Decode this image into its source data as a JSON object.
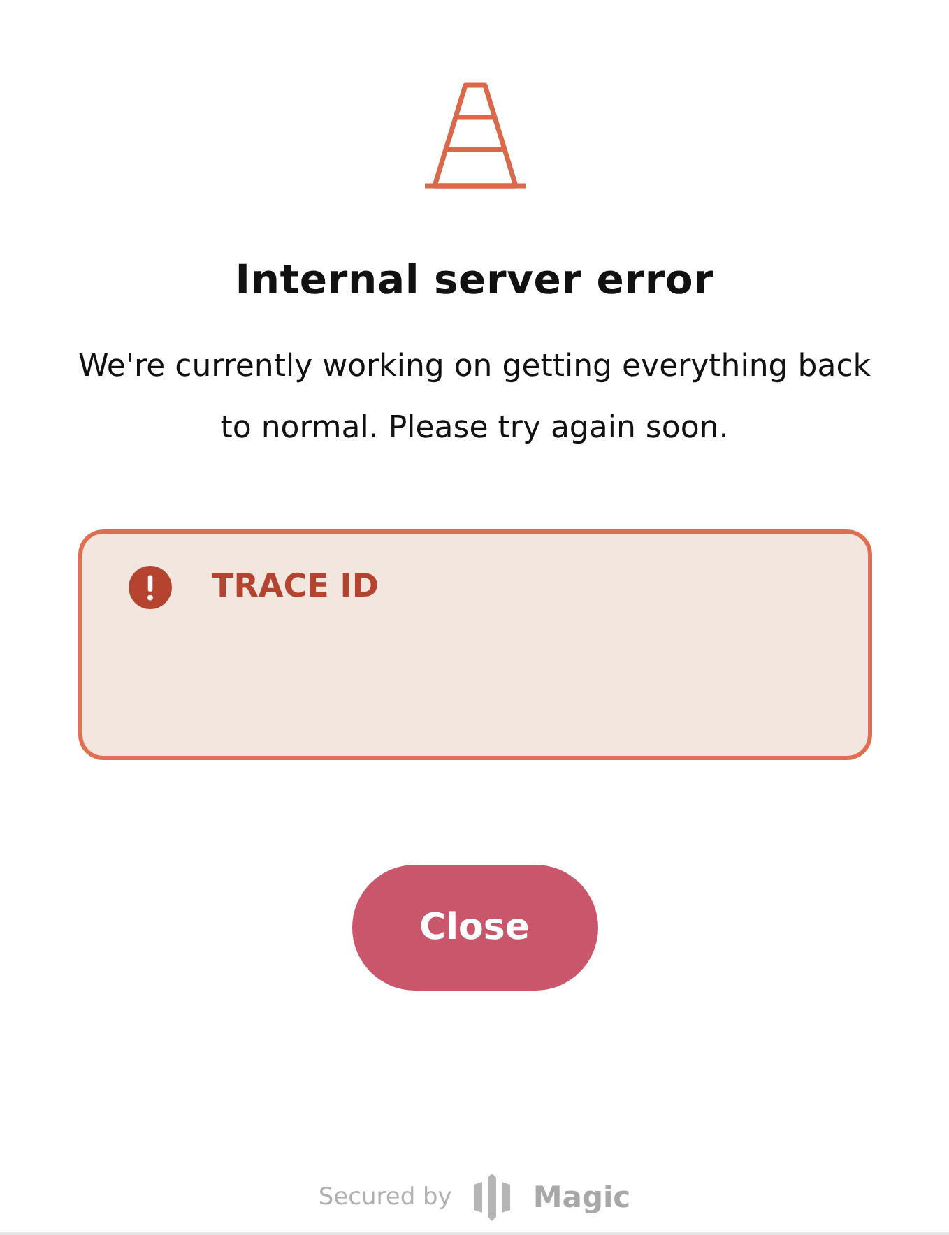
{
  "title": "Internal server error",
  "message": "We're currently working on getting everything back to normal. Please try again soon.",
  "trace": {
    "label": "TRACE ID"
  },
  "close_button": {
    "label": "Close"
  },
  "footer": {
    "prefix": "Secured by",
    "brand": "Magic"
  }
}
